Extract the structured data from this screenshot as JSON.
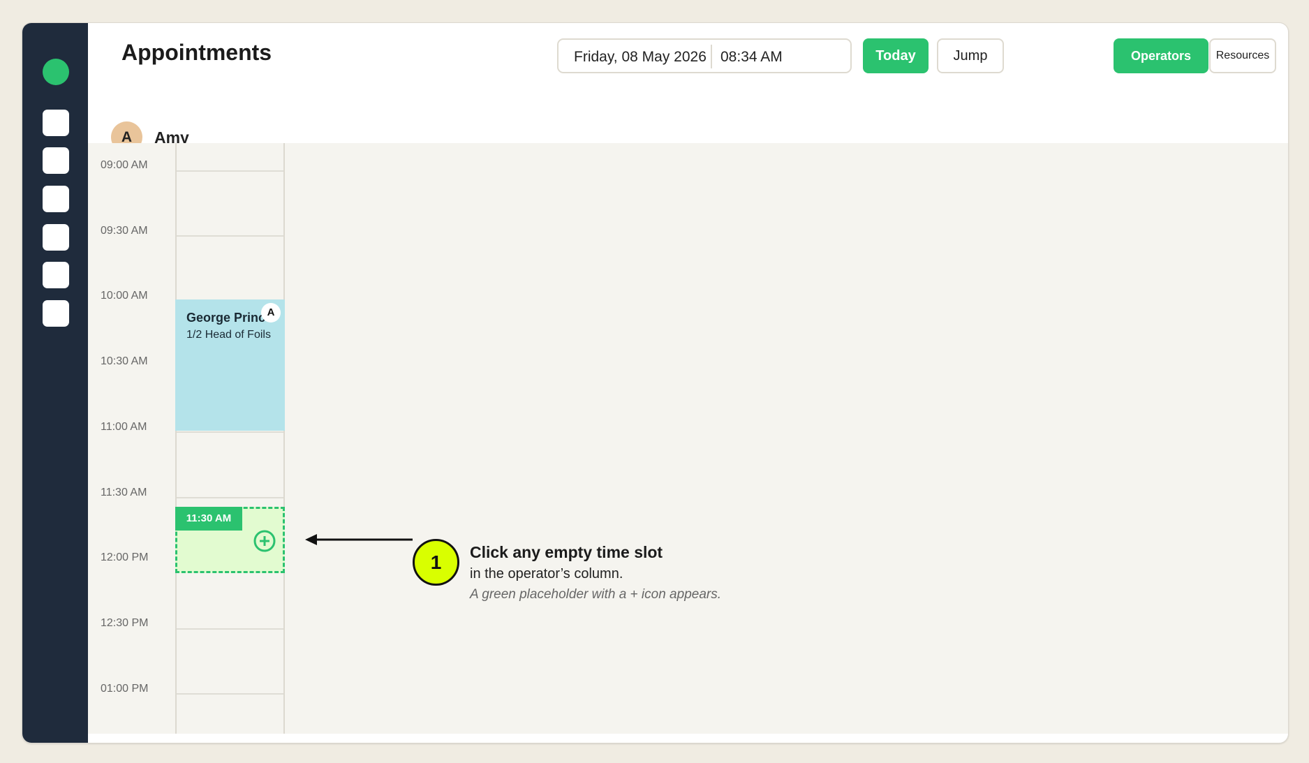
{
  "page": {
    "title": "Appointments"
  },
  "header": {
    "date": "Friday, 08 May 2026",
    "time": "08:34 AM",
    "today_label": "Today",
    "jump_label": "Jump",
    "view_operators_label": "Operators",
    "view_resources_label": "Resources",
    "active_view": "Operators"
  },
  "sidebar": {
    "icons": [
      "logo-icon",
      "nav-icon",
      "nav-icon",
      "nav-icon",
      "nav-icon",
      "nav-icon",
      "nav-icon"
    ]
  },
  "operator": {
    "initial": "A",
    "name": "Amy"
  },
  "time_slots": [
    "09:00 AM",
    "09:30 AM",
    "10:00 AM",
    "10:30 AM",
    "11:00 AM",
    "11:30 AM",
    "12:00 PM",
    "12:30 PM",
    "01:00 PM"
  ],
  "appointment": {
    "client": "George Prince",
    "service": "1/2 Head of Foils",
    "operator_initial": "A",
    "start": "10:00 AM",
    "end": "11:00 AM"
  },
  "placeholder": {
    "time": "11:30 AM",
    "icon": "plus-circle-icon"
  },
  "instruction": {
    "step": "1",
    "title": "Click any empty time slot",
    "line2": "in the operator’s column.",
    "line3": "A green placeholder with a + icon appears."
  },
  "colors": {
    "accent": "#2bc26f",
    "sidebar": "#1f2b3c",
    "appointment": "#b4e3ea",
    "placeholder": "#e2fbd0",
    "step_marker": "#d9ff00"
  }
}
